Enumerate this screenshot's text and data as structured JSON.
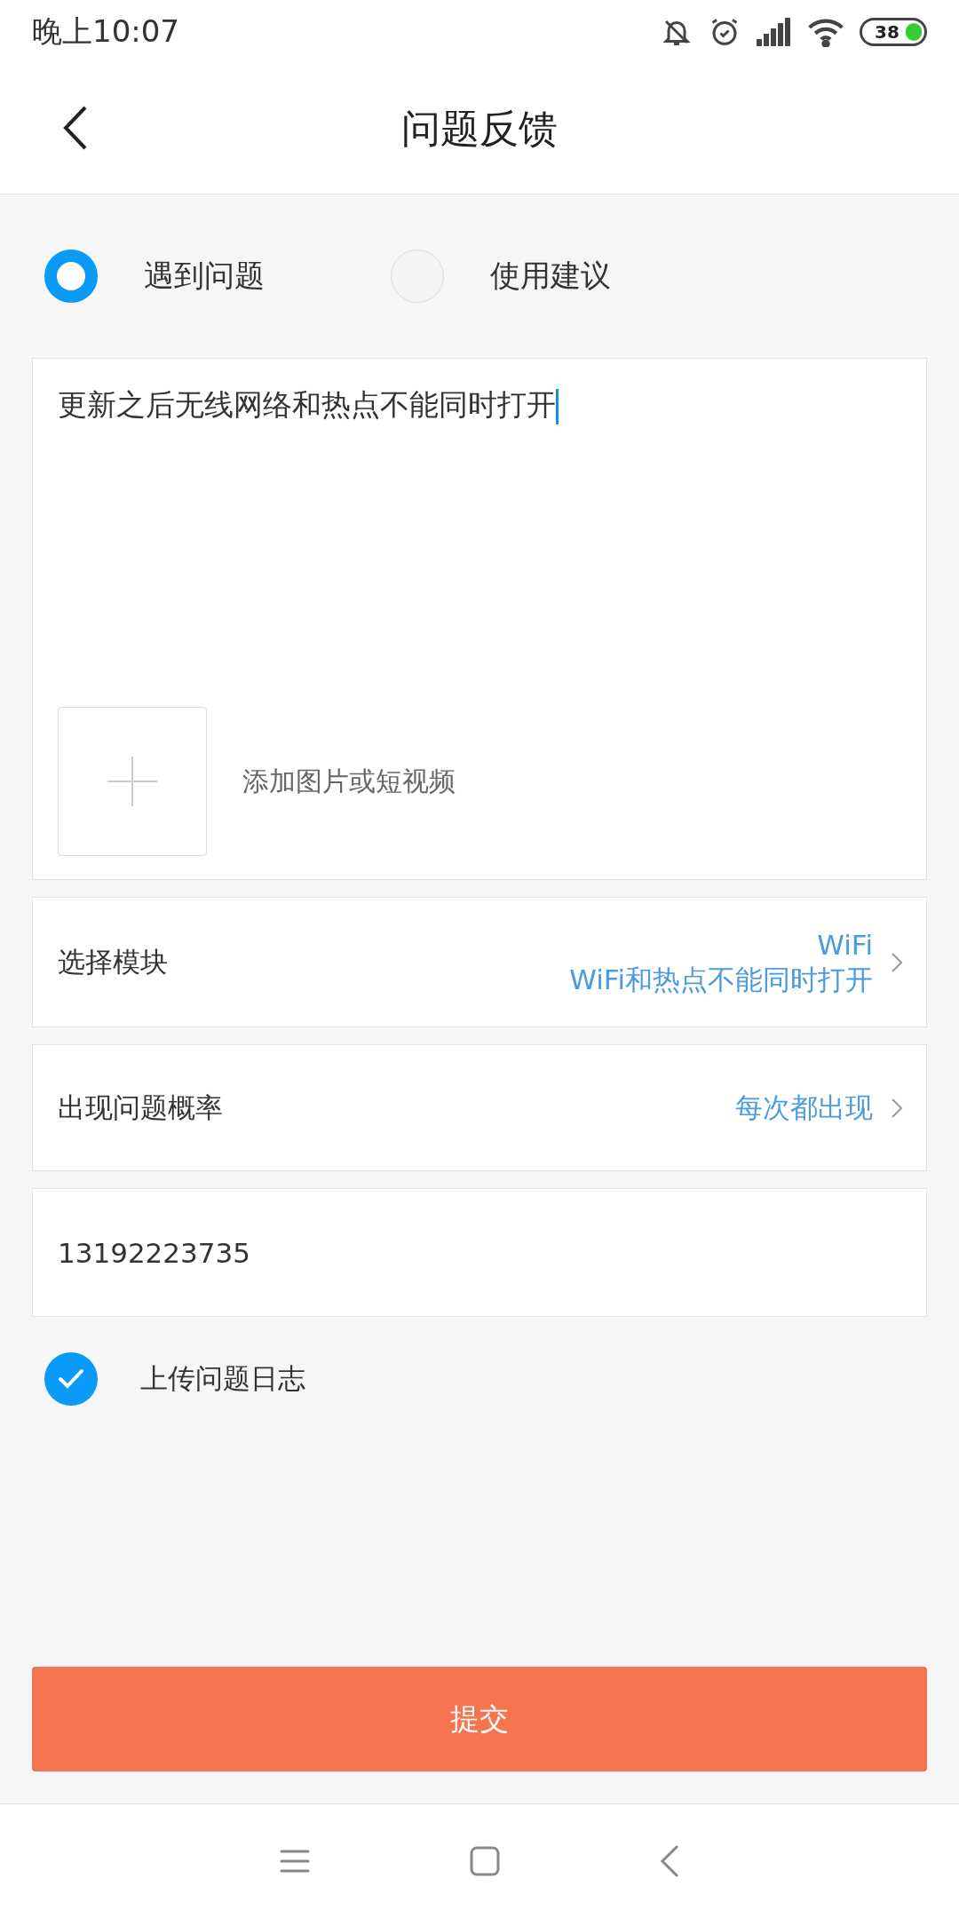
{
  "status_bar": {
    "time": "晚上10:07",
    "battery": "38"
  },
  "header": {
    "title": "问题反馈"
  },
  "feedback_types": [
    {
      "label": "遇到问题",
      "selected": true
    },
    {
      "label": "使用建议",
      "selected": false
    }
  ],
  "description": {
    "value": "更新之后无线网络和热点不能同时打开",
    "attach_label": "添加图片或短视频"
  },
  "module": {
    "label": "选择模块",
    "value": "WiFi",
    "detail": "WiFi和热点不能同时打开"
  },
  "frequency": {
    "label": "出现问题概率",
    "value": "每次都出现"
  },
  "contact": {
    "value": "13192223735"
  },
  "upload_log": {
    "label": "上传问题日志",
    "checked": true
  },
  "submit": {
    "label": "提交"
  }
}
